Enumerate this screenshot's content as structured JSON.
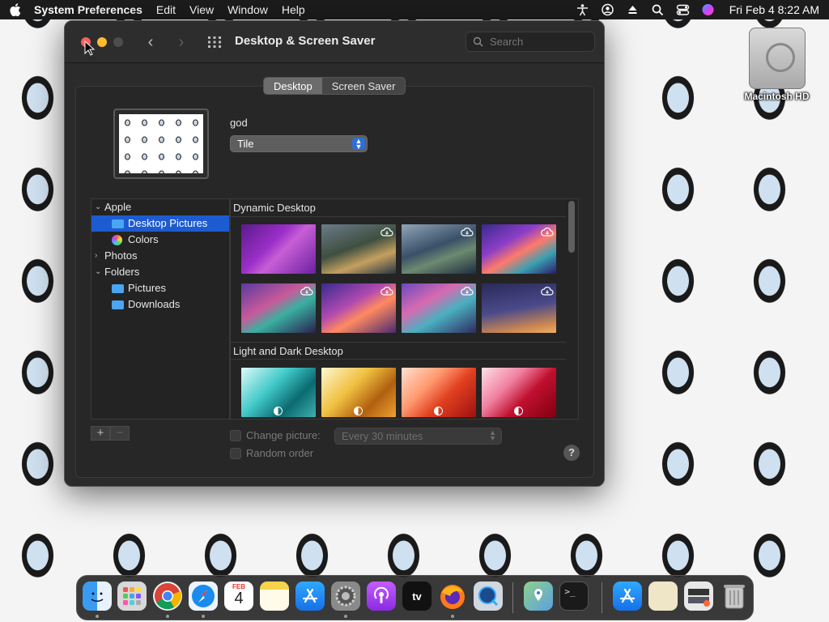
{
  "menubar": {
    "app_name": "System Preferences",
    "menus": [
      "Edit",
      "View",
      "Window",
      "Help"
    ],
    "clock": "Fri Feb 4  8:22 AM"
  },
  "desktop": {
    "drive_label": "Macintosh HD"
  },
  "window": {
    "title": "Desktop & Screen Saver",
    "search_placeholder": "Search",
    "tabs": [
      "Desktop",
      "Screen Saver"
    ],
    "active_tab": "Desktop",
    "wallpaper_name": "god",
    "fit_option": "Tile",
    "sidebar": [
      {
        "label": "Apple",
        "level": 1,
        "expanded": true
      },
      {
        "label": "Desktop Pictures",
        "level": 2,
        "selected": true
      },
      {
        "label": "Colors",
        "level": 2
      },
      {
        "label": "Photos",
        "level": 1,
        "expanded": false
      },
      {
        "label": "Folders",
        "level": 1,
        "expanded": true
      },
      {
        "label": "Pictures",
        "level": 2
      },
      {
        "label": "Downloads",
        "level": 2
      }
    ],
    "sidebar_add": "+",
    "sidebar_remove": "−",
    "gallery_sections": [
      "Dynamic Desktop",
      "Light and Dark Desktop"
    ],
    "change_picture_label": "Change picture:",
    "change_interval": "Every 30 minutes",
    "random_order_label": "Random order",
    "help_label": "?"
  },
  "dock": {
    "calendar_month": "FEB",
    "calendar_day": "4",
    "tv_label": "tv"
  }
}
